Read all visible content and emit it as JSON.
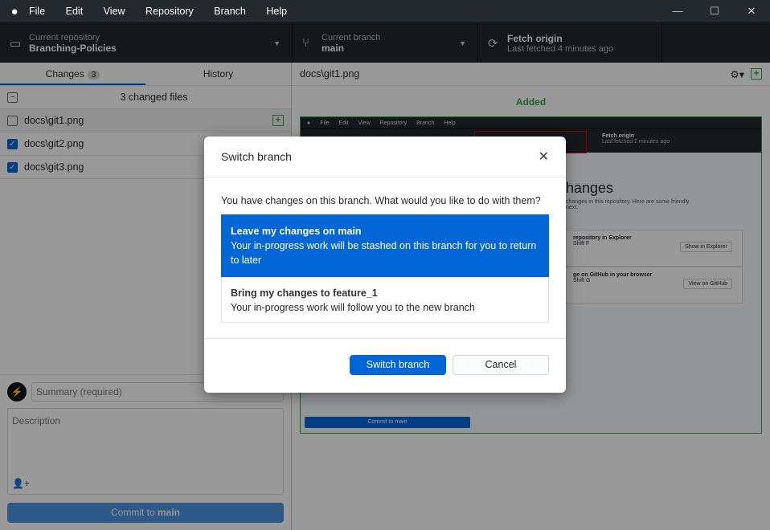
{
  "menu": [
    "File",
    "Edit",
    "View",
    "Repository",
    "Branch",
    "Help"
  ],
  "window_controls": {
    "minimize": "—",
    "maximize": "☐",
    "close": "✕"
  },
  "toolbar": {
    "repo": {
      "label": "Current repository",
      "value": "Branching-Policies"
    },
    "branch": {
      "label": "Current branch",
      "value": "main"
    },
    "fetch": {
      "label": "Fetch origin",
      "value": "Last fetched 4 minutes ago"
    }
  },
  "tabs": {
    "changes": "Changes",
    "changes_count": "3",
    "history": "History"
  },
  "changes": {
    "header": "3 changed files",
    "files": [
      {
        "name": "docs\\git1.png",
        "checked": false
      },
      {
        "name": "docs\\git2.png",
        "checked": true
      },
      {
        "name": "docs\\git3.png",
        "checked": true
      }
    ]
  },
  "commit": {
    "summary_placeholder": "Summary (required)",
    "description_placeholder": "Description",
    "button_prefix": "Commit to ",
    "button_branch": "main"
  },
  "diff": {
    "path": "docs\\git1.png",
    "status": "Added",
    "image": {
      "menu": [
        "File",
        "Edit",
        "View",
        "Repository",
        "Branch",
        "Help"
      ],
      "fetch": "Fetch origin",
      "fetched": "Last fetched 2 minutes ago",
      "heading": "hanges",
      "line1": "changes in this repository. Here are some friendly",
      "line2": "next.",
      "card1": "repository in Explorer",
      "card1_keys": "Shift  F",
      "card1_btn": "Show in Explorer",
      "card2": "ge on GitHub in your browser",
      "card2_keys": "Shift  G",
      "card2_btn": "View on GitHub",
      "commit": "Commit to main"
    }
  },
  "dialog": {
    "title": "Switch branch",
    "question": "You have changes on this branch. What would you like to do with them?",
    "options": [
      {
        "title": "Leave my changes on main",
        "desc": "Your in-progress work will be stashed on this branch for you to return to later",
        "selected": true
      },
      {
        "title": "Bring my changes to feature_1",
        "desc": "Your in-progress work will follow you to the new branch",
        "selected": false
      }
    ],
    "primary": "Switch branch",
    "cancel": "Cancel"
  },
  "colors": {
    "accent": "#0366d6",
    "added": "#28a745",
    "toolbar": "#24292e"
  }
}
